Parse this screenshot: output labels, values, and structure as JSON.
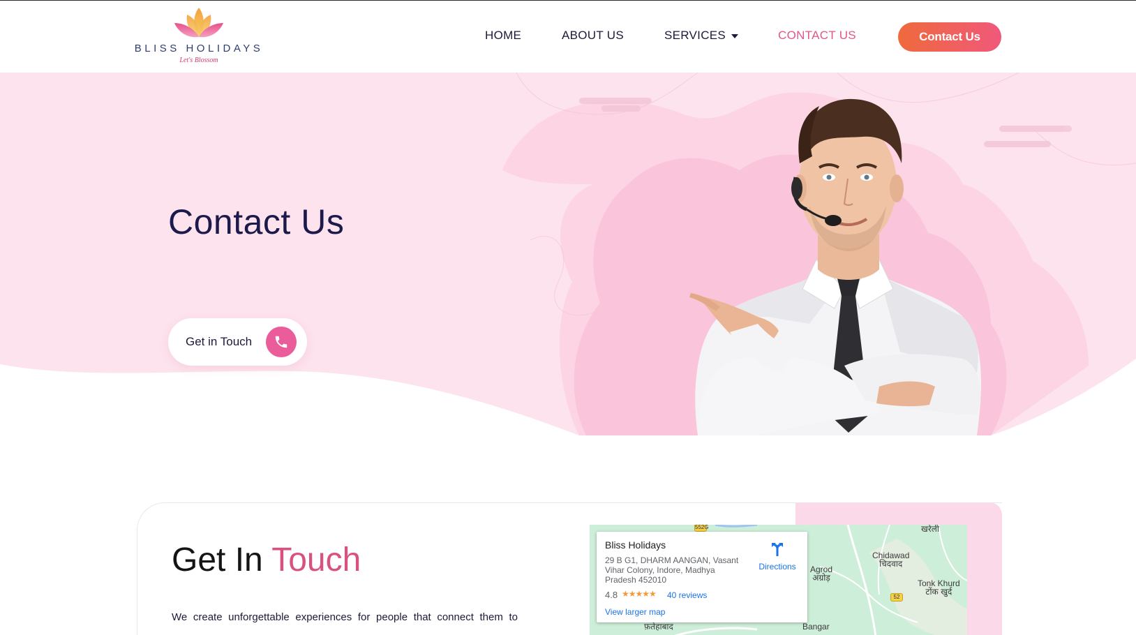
{
  "brand": {
    "name": "BLISS HOLIDAYS",
    "tagline": "Let's Blossom"
  },
  "nav": {
    "items": [
      {
        "label": "HOME",
        "active": false
      },
      {
        "label": "ABOUT US",
        "active": false
      },
      {
        "label": "SERVICES",
        "active": false,
        "has_dropdown": true
      },
      {
        "label": "CONTACT US",
        "active": true
      }
    ],
    "cta_label": "Contact Us"
  },
  "hero": {
    "title": "Contact Us",
    "button_label": "Get in Touch",
    "button_icon": "phone-icon"
  },
  "get_in_touch": {
    "title_part1": "Get In",
    "title_part2": "Touch",
    "paragraph": "We create unforgettable experiences for people that connect them to"
  },
  "map": {
    "place_name": "Bliss Holidays",
    "address": "29 B G1, DHARM AANGAN, Vasant Vihar Colony, Indore, Madhya Pradesh 452010",
    "rating": "4.8",
    "stars": "★★★★★",
    "reviews_label": "40 reviews",
    "directions_label": "Directions",
    "larger_map_label": "View larger map",
    "places": {
      "agrod": "Agrod",
      "agrod_hi": "अग्रोड़",
      "chidawad": "Chidawad",
      "chidawad_hi": "चिदवाद",
      "tonk_khurd": "Tonk Khurd",
      "tonk_khurd_hi": "टोंक खुर्द",
      "bangar": "Bangar",
      "fatehabad_hi": "फ़तेहाबाद",
      "kheli_hi": "खरेली"
    },
    "road_52": "52",
    "road_552g": "552G"
  },
  "colors": {
    "accent_pink": "#e0568d",
    "cta_gradient_start": "#ef6a3c",
    "cta_gradient_end": "#f0587b",
    "hero_bg": "#fde3ee",
    "navy": "#1c1a3a"
  }
}
